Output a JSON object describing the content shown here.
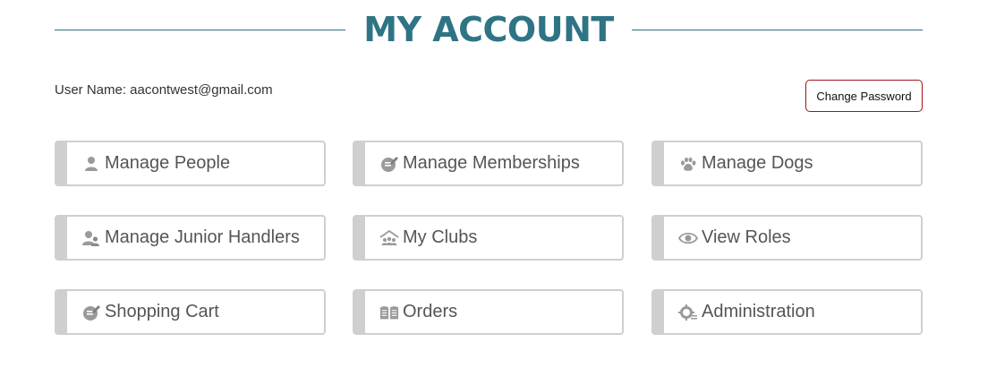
{
  "header": {
    "title": "MY ACCOUNT"
  },
  "account": {
    "username": "User Name: aacontwest@gmail.com",
    "change_password_label": "Change Password"
  },
  "tiles": [
    {
      "label": "Manage People",
      "icon": "person-icon"
    },
    {
      "label": "Manage Memberships",
      "icon": "membership-edit-icon"
    },
    {
      "label": "Manage Dogs",
      "icon": "paw-icon"
    },
    {
      "label": "Manage Junior Handlers",
      "icon": "junior-handlers-icon"
    },
    {
      "label": "My Clubs",
      "icon": "club-house-icon"
    },
    {
      "label": "View Roles",
      "icon": "eye-icon"
    },
    {
      "label": "Shopping Cart",
      "icon": "cart-edit-icon"
    },
    {
      "label": "Orders",
      "icon": "book-icon"
    },
    {
      "label": "Administration",
      "icon": "admin-gear-icon"
    }
  ],
  "colors": {
    "title": "#2f7485",
    "rule": "#2f6f80",
    "tile_border": "#cfcfcf",
    "tile_text": "#555555",
    "icon": "#9a9a9a",
    "button_border": "#a3101c"
  }
}
